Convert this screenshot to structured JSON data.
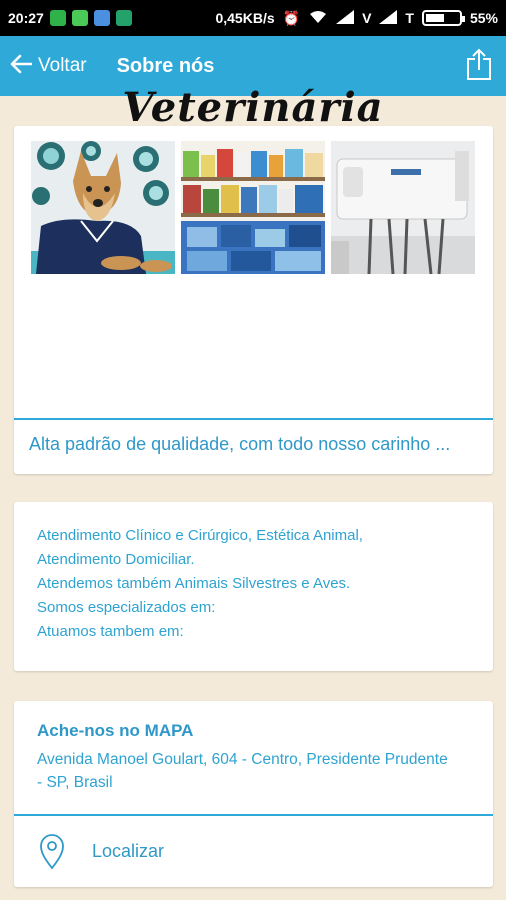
{
  "status_bar": {
    "time": "20:27",
    "network_speed": "0,45KB/s",
    "carrier1": "V",
    "carrier2": "T",
    "battery": "55%",
    "battery_level": 0.55
  },
  "app_bar": {
    "back_label": "Voltar",
    "title": "Sobre nós",
    "color": "#2fa9d8"
  },
  "brand_text": "Veterinária",
  "gallery": {
    "images": [
      "dog-in-vet-coat",
      "pet-food-shelves",
      "dental-equipment"
    ],
    "caption": "Alta padrão de qualidade, com todo nosso carinho ..."
  },
  "info": {
    "lines": [
      "Atendimento Clínico e Cirúrgico, Estética Animal,",
      "Atendimento Domiciliar.",
      "Atendemos também Animais Silvestres e Aves.",
      "Somos especializados em:",
      "Atuamos tambem em:"
    ]
  },
  "map": {
    "title": "Ache-nos no MAPA",
    "address": "Avenida Manoel Goulart, 604 - Centro, Presidente Prudente - SP, Brasil",
    "button_label": "Localizar",
    "icon": "location-pin-icon"
  }
}
